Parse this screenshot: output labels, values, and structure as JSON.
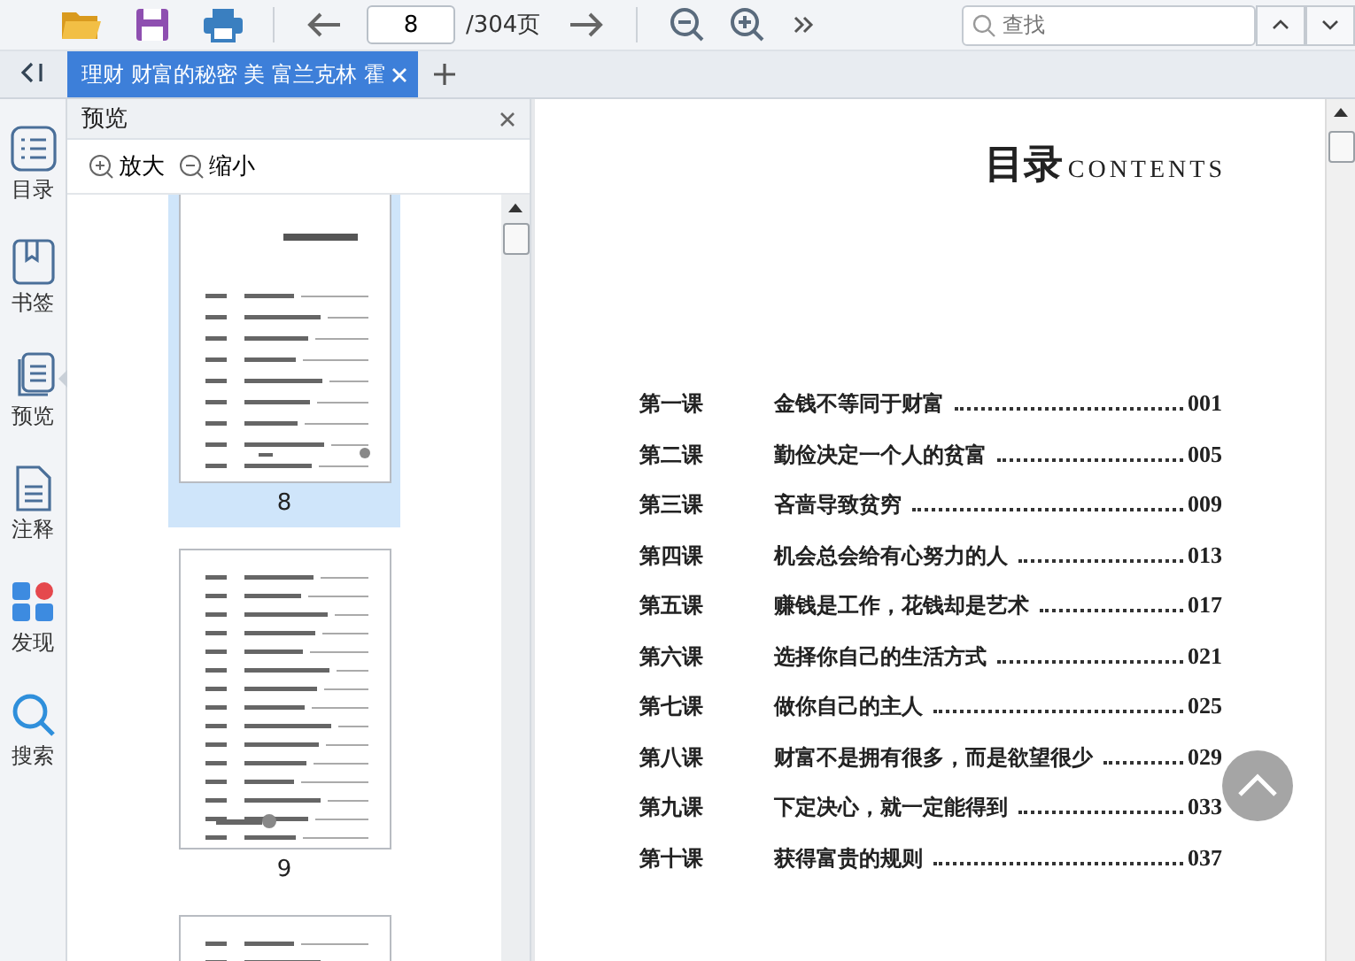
{
  "toolbar": {
    "page_number": "8",
    "page_total": "/304页",
    "search": {
      "placeholder": "查找"
    }
  },
  "tabs": [
    {
      "label": "理财 财富的秘密 美 富兰克林 霍",
      "selected": true
    }
  ],
  "sidebar": {
    "items": [
      {
        "kind": "list",
        "label": "目录",
        "selected": false
      },
      {
        "kind": "bookmark",
        "label": "书签",
        "selected": false
      },
      {
        "kind": "pages",
        "label": "预览",
        "selected": true
      },
      {
        "kind": "note",
        "label": "注释",
        "selected": false
      },
      {
        "kind": "apps",
        "label": "发现",
        "selected": false
      },
      {
        "kind": "search",
        "label": "搜索",
        "selected": false
      }
    ]
  },
  "preview_panel": {
    "title": "预览",
    "zoom_in": "放大",
    "zoom_out": "缩小",
    "thumbnails": [
      {
        "page": "8",
        "selected": true
      },
      {
        "page": "9",
        "selected": false
      },
      {
        "selected": false
      }
    ]
  },
  "document": {
    "title": "目录",
    "title_en": "CONTENTS",
    "entries": [
      {
        "lesson": "第一课",
        "title": "金钱不等同于财富",
        "page": "001"
      },
      {
        "lesson": "第二课",
        "title": "勤俭决定一个人的贫富",
        "page": "005"
      },
      {
        "lesson": "第三课",
        "title": "吝啬导致贫穷",
        "page": "009"
      },
      {
        "lesson": "第四课",
        "title": "机会总会给有心努力的人",
        "page": "013"
      },
      {
        "lesson": "第五课",
        "title": "赚钱是工作，花钱却是艺术",
        "page": "017"
      },
      {
        "lesson": "第六课",
        "title": "选择你自己的生活方式",
        "page": "021"
      },
      {
        "lesson": "第七课",
        "title": "做你自己的主人",
        "page": "025"
      },
      {
        "lesson": "第八课",
        "title": "财富不是拥有很多，而是欲望很少",
        "page": "029"
      },
      {
        "lesson": "第九课",
        "title": "下定决心，就一定能得到",
        "page": "033"
      },
      {
        "lesson": "第十课",
        "title": "获得富贵的规则",
        "page": "037"
      }
    ]
  }
}
